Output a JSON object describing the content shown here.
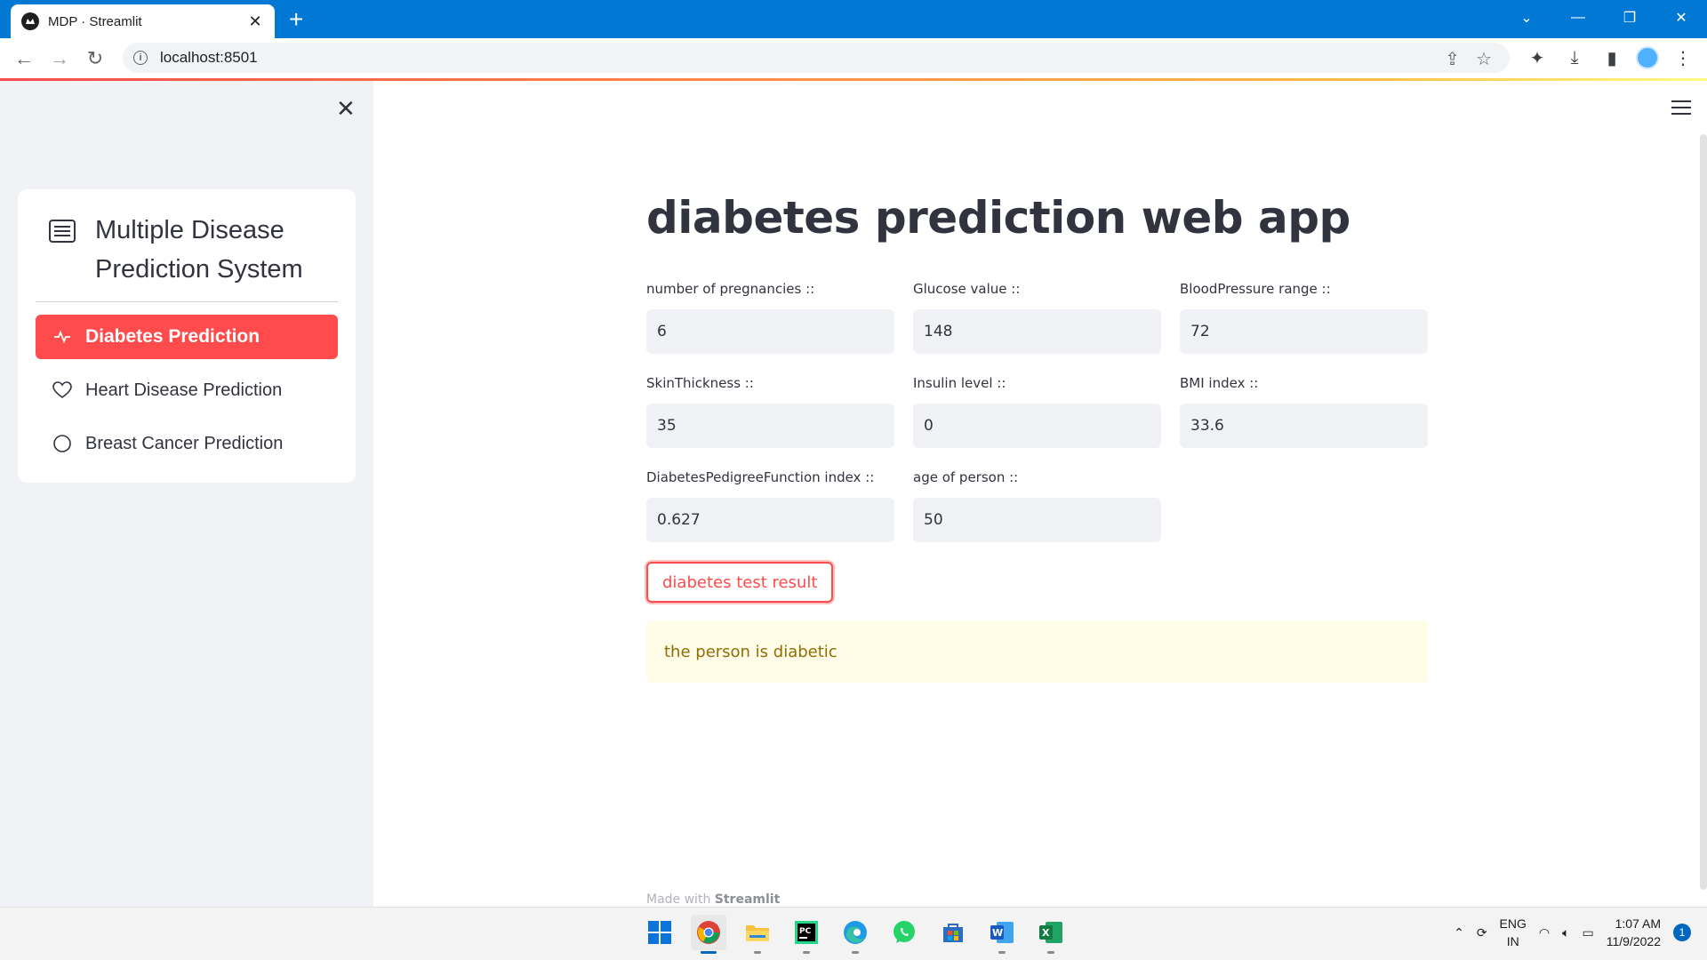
{
  "browser": {
    "tab_title": "MDP · Streamlit",
    "tab_close": "✕",
    "new_tab": "+",
    "url": "localhost:8501"
  },
  "sidebar": {
    "close_label": "✕",
    "menu_title": "Multiple Disease Prediction System",
    "items": [
      {
        "label": "Diabetes Prediction",
        "icon": "activity-icon",
        "active": true
      },
      {
        "label": "Heart Disease Prediction",
        "icon": "heart-icon",
        "active": false
      },
      {
        "label": "Breast Cancer Prediction",
        "icon": "circle-icon",
        "active": false
      }
    ]
  },
  "main": {
    "title": "diabetes prediction web app",
    "fields": [
      {
        "label": "number of pregnancies ::",
        "value": "6"
      },
      {
        "label": "Glucose value ::",
        "value": "148"
      },
      {
        "label": "BloodPressure range ::",
        "value": "72"
      },
      {
        "label": "SkinThickness ::",
        "value": "35"
      },
      {
        "label": "Insulin level ::",
        "value": "0"
      },
      {
        "label": "BMI index ::",
        "value": "33.6"
      },
      {
        "label": "DiabetesPedigreeFunction index ::",
        "value": "0.627"
      },
      {
        "label": "age of person ::",
        "value": "50"
      }
    ],
    "button_label": "diabetes test result",
    "result_text": "the person is diabetic",
    "footer_prefix": "Made with",
    "footer_brand": "Streamlit"
  },
  "taskbar": {
    "lang_line1": "ENG",
    "lang_line2": "IN",
    "time": "1:07 AM",
    "date": "11/9/2022",
    "notifications": "1"
  },
  "colors": {
    "accent": "#ff4b4b",
    "sidebar_bg": "#f0f2f6",
    "alert_bg": "#fffce7",
    "alert_text": "#926c05",
    "chrome_blue": "#0078d4"
  }
}
